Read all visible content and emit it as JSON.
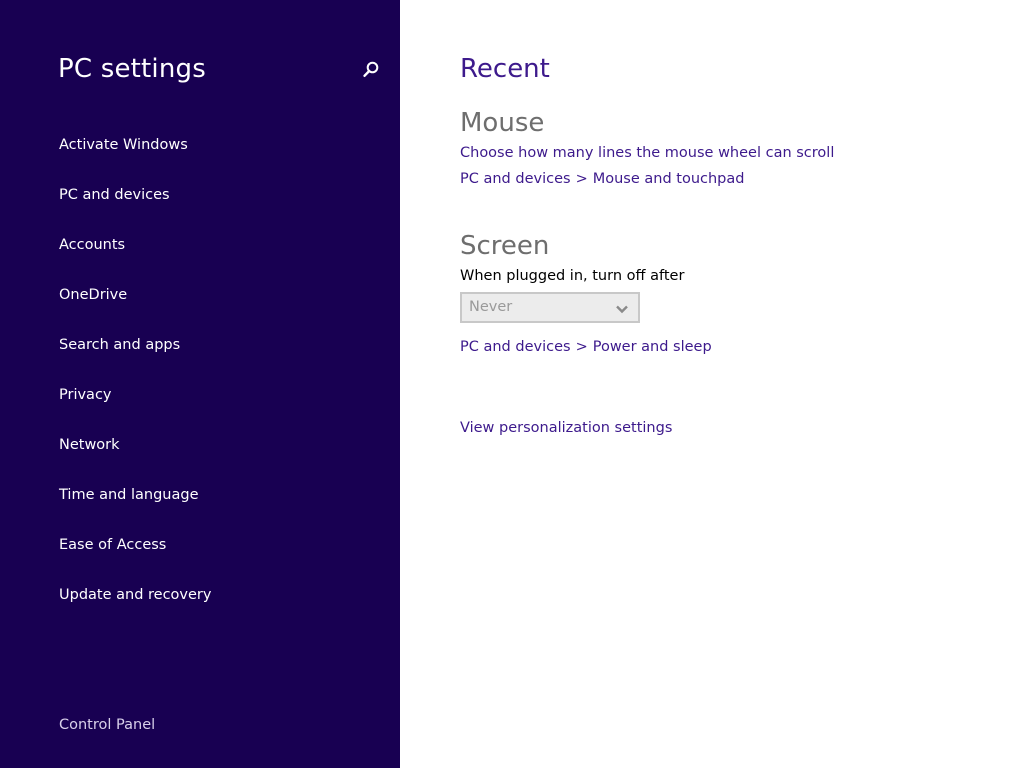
{
  "sidebar": {
    "title": "PC settings",
    "search_icon": "search-icon",
    "items": [
      {
        "label": "Activate Windows"
      },
      {
        "label": "PC and devices"
      },
      {
        "label": "Accounts"
      },
      {
        "label": "OneDrive"
      },
      {
        "label": "Search and apps"
      },
      {
        "label": "Privacy"
      },
      {
        "label": "Network"
      },
      {
        "label": "Time and language"
      },
      {
        "label": "Ease of Access"
      },
      {
        "label": "Update and recovery"
      }
    ],
    "control_panel": "Control Panel"
  },
  "main": {
    "title": "Recent",
    "mouse": {
      "heading": "Mouse",
      "link": "Choose how many lines the mouse wheel can scroll",
      "crumb_parent": "PC and devices",
      "crumb_separator": ">",
      "crumb_child": "Mouse and touchpad"
    },
    "screen": {
      "heading": "Screen",
      "label": "When plugged in, turn off after",
      "select_value": "Never",
      "crumb_parent": "PC and devices",
      "crumb_separator": ">",
      "crumb_child": "Power and sleep"
    },
    "personalization_link": "View personalization settings"
  },
  "colors": {
    "sidebar_bg": "#180052",
    "accent": "#3d1a8c",
    "heading_gray": "#6e6e6e"
  }
}
